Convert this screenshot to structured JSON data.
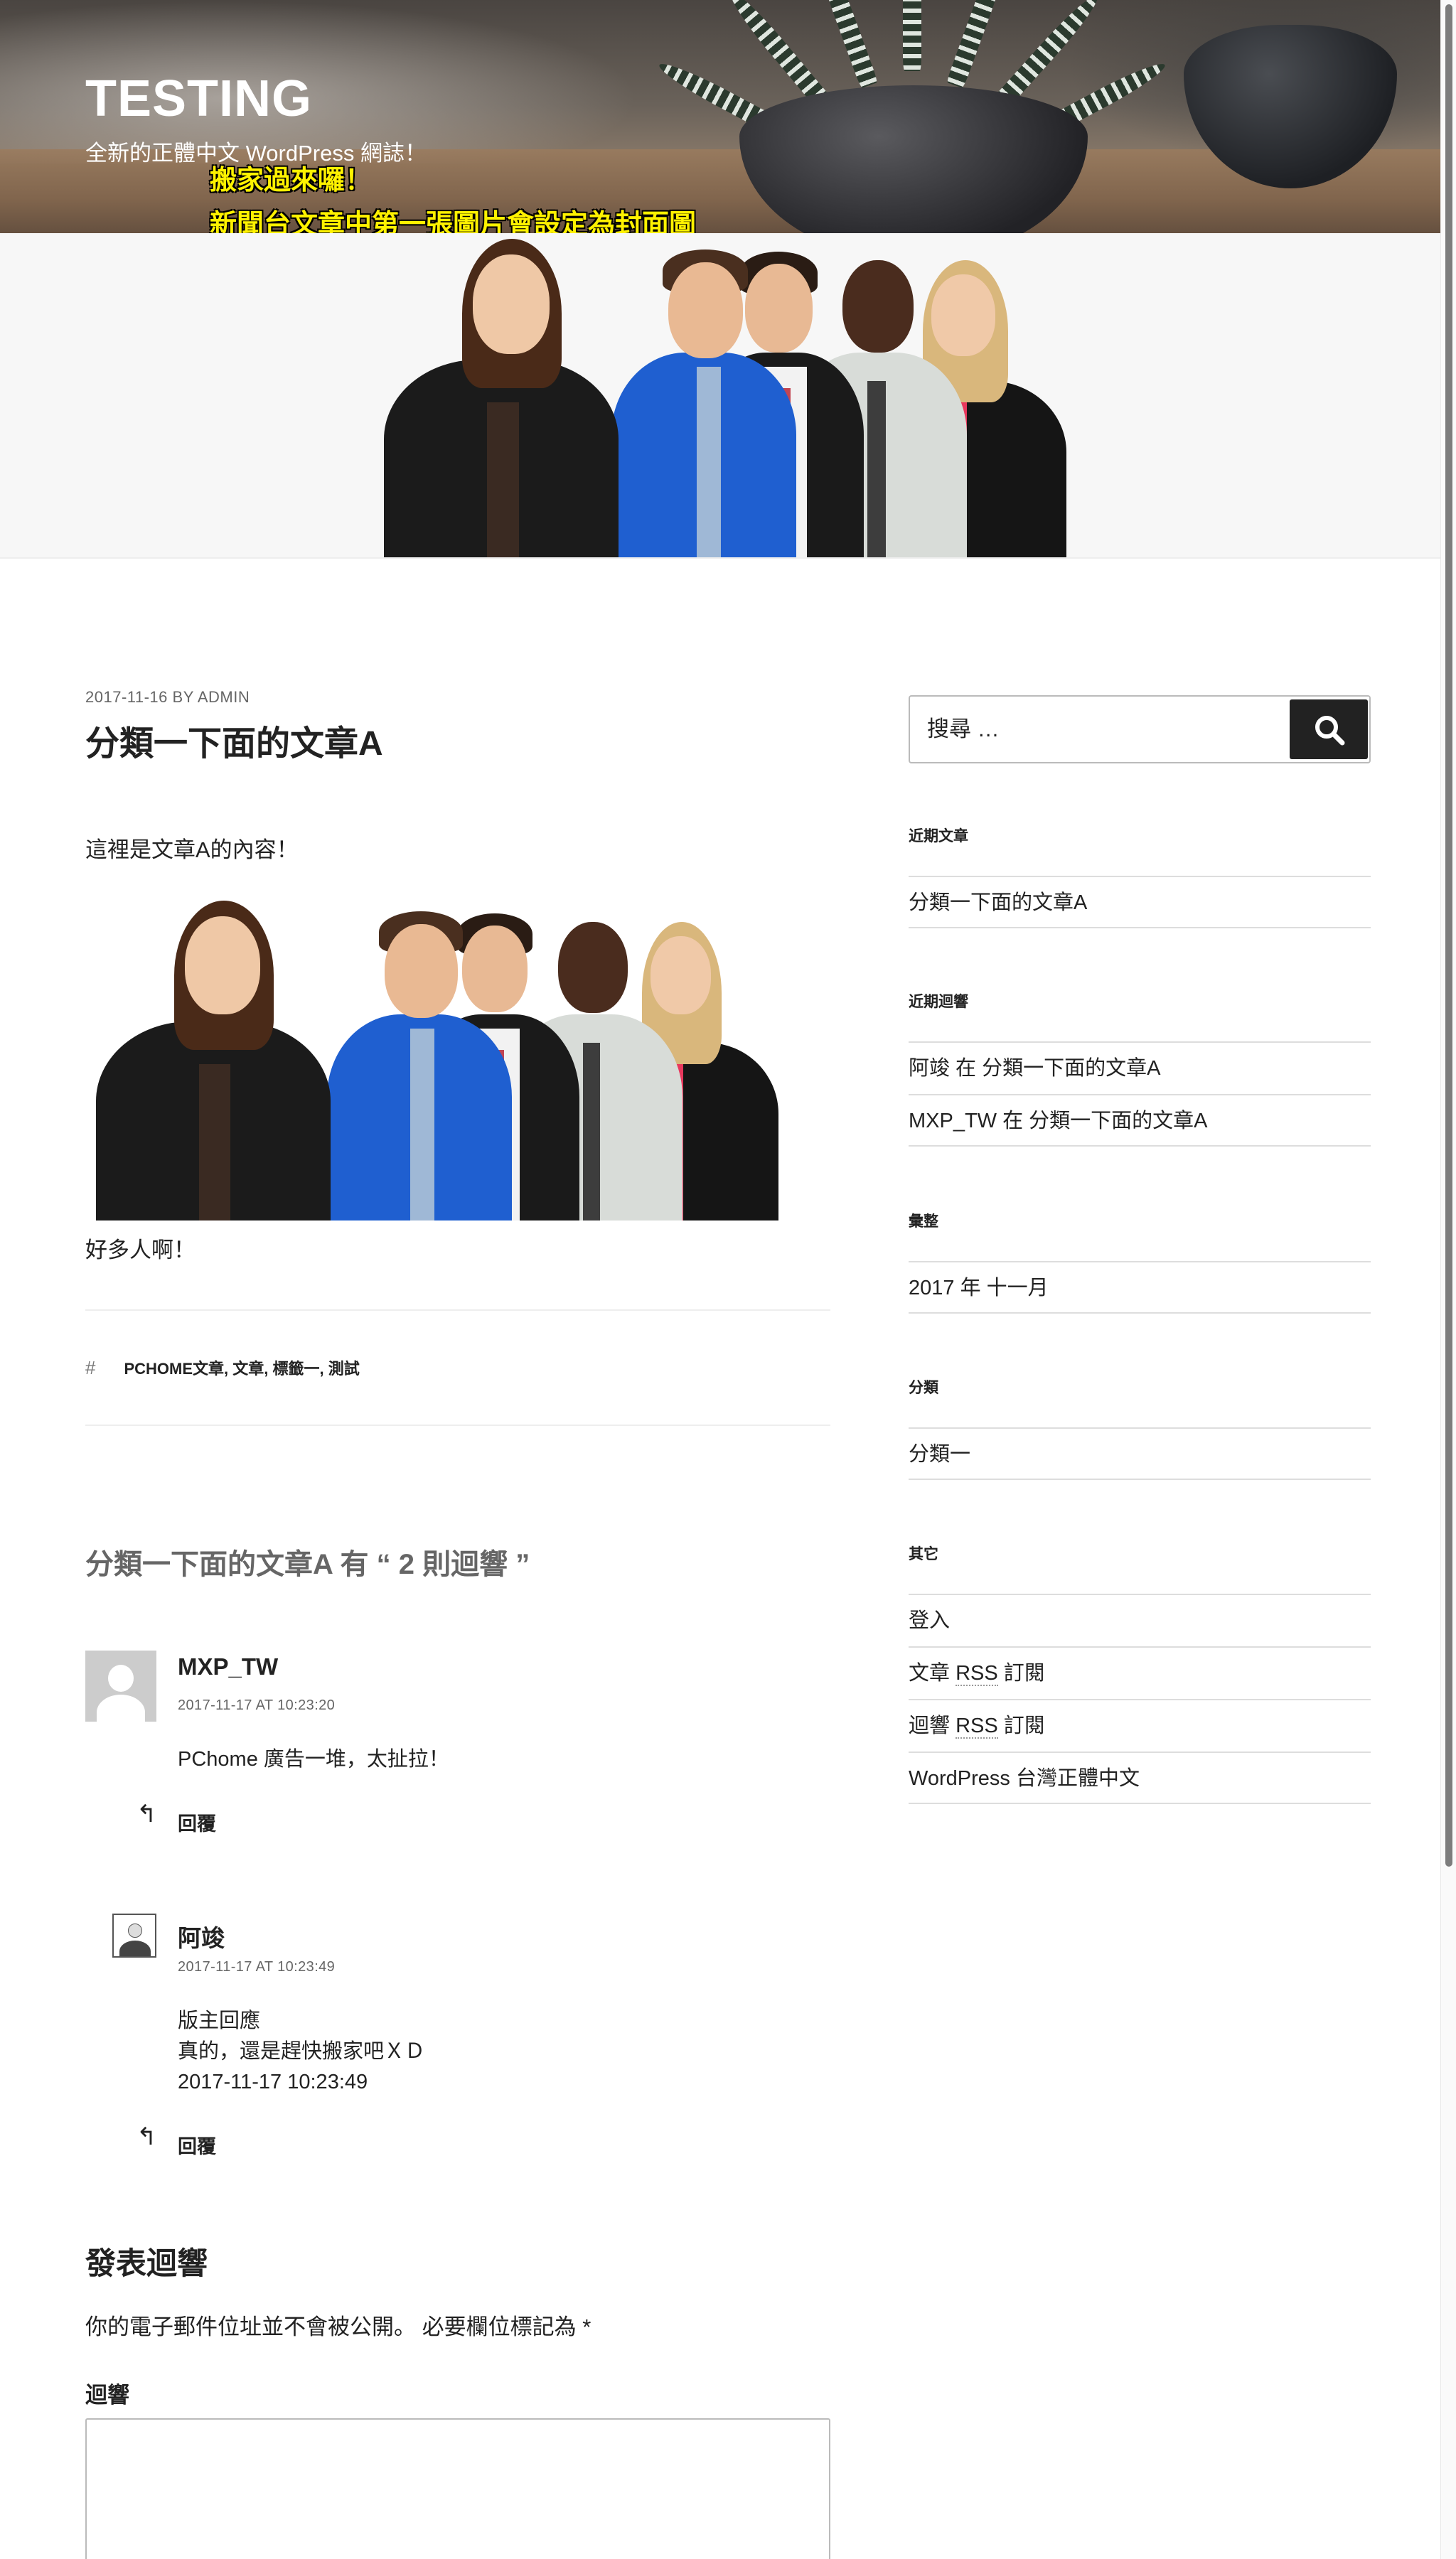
{
  "site": {
    "title": "TESTING",
    "description": "全新的正體中文 WordPress 網誌！",
    "notice_line1": "搬家過來囉！",
    "notice_line2": "新聞台文章中第一張圖片會設定為封面圖"
  },
  "post": {
    "meta": "2017-11-16 BY ADMIN",
    "title": "分類一下面的文章A",
    "content_intro": "這裡是文章A的內容！",
    "content_outro": "好多人啊！",
    "tags": "PCHOME文章, 文章, 標籤一, 測試"
  },
  "comments": {
    "title": "分類一下面的文章A 有 “ 2 則迴響 ”",
    "items": [
      {
        "author": "MXP_TW",
        "date": "2017-11-17 AT 10:23:20",
        "text_line1": "PChome 廣告一堆，太扯拉！",
        "reply_label": "回覆"
      },
      {
        "author": "阿竣",
        "date": "2017-11-17 AT 10:23:49",
        "text_line1": "版主回應",
        "text_line2": "真的，還是趕快搬家吧ＸＤ",
        "text_line3": "2017-11-17 10:23:49",
        "reply_label": "回覆"
      }
    ]
  },
  "respond": {
    "title": "發表迴響",
    "notes": "你的電子郵件位址並不會被公開。 必要欄位標記為 *",
    "comment_label": "迴響"
  },
  "sidebar": {
    "search_placeholder": "搜尋 …",
    "recent_posts": {
      "title": "近期文章",
      "items": [
        "分類一下面的文章A"
      ]
    },
    "recent_comments": {
      "title": "近期迴響",
      "items": [
        "阿竣 在 分類一下面的文章A",
        "MXP_TW 在 分類一下面的文章A"
      ]
    },
    "archives": {
      "title": "彙整",
      "items": [
        "2017 年 十一月"
      ]
    },
    "categories": {
      "title": "分類",
      "items": [
        "分類一"
      ]
    },
    "meta": {
      "title": "其它",
      "login": "登入",
      "entries_rss_pre": "文章 ",
      "entries_rss_abbr": "RSS",
      "entries_rss_post": " 訂閱",
      "comments_rss_pre": "迴響 ",
      "comments_rss_abbr": "RSS",
      "comments_rss_post": " 訂閱",
      "wordpress_link": "WordPress 台灣正體中文"
    }
  },
  "colors": {
    "notice_yellow": "#fff200",
    "text": "#222222",
    "muted": "#666666",
    "search_button": "#222222"
  }
}
